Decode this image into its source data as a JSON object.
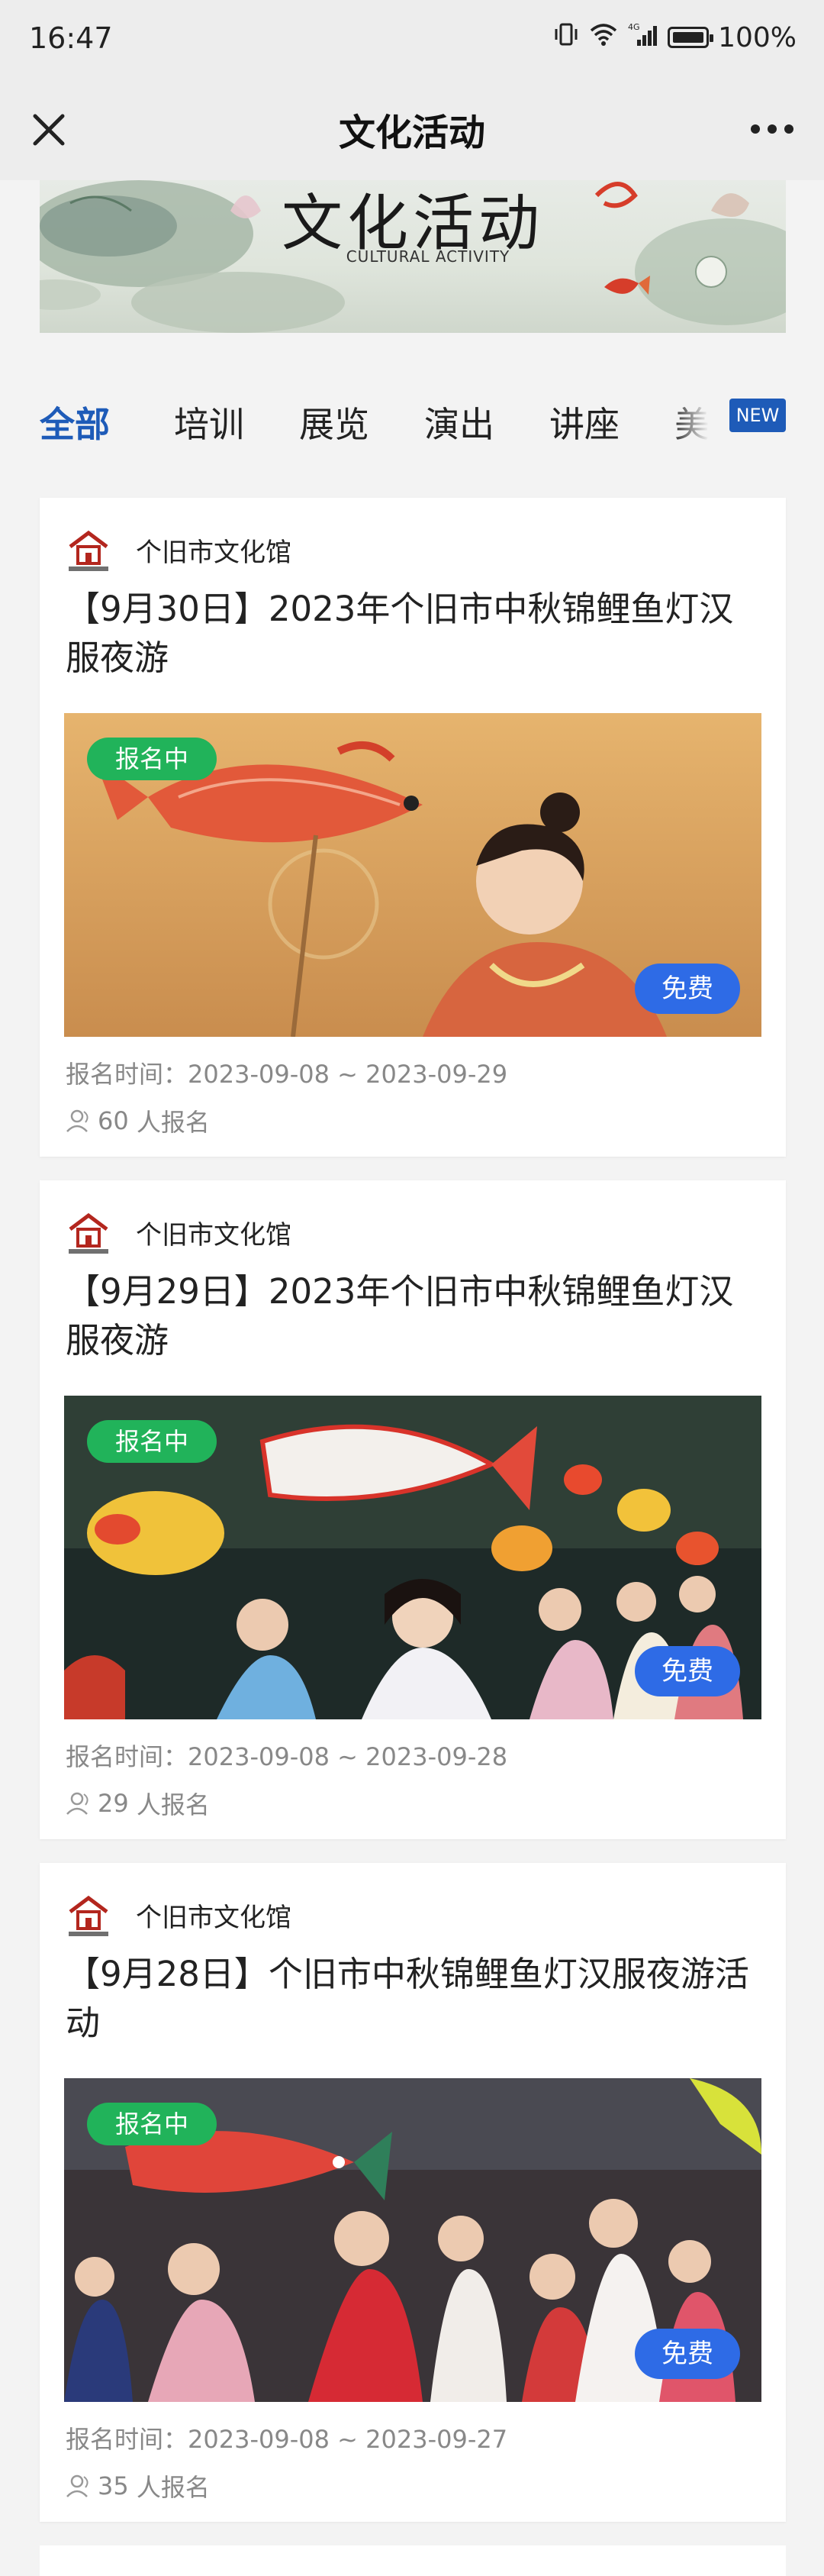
{
  "status_bar": {
    "time": "16:47",
    "battery": "100%",
    "network": "4G"
  },
  "nav": {
    "title": "文化活动",
    "close_icon": "close-icon",
    "more_icon": "more-icon"
  },
  "banner": {
    "title": "文化活动",
    "subtitle": "CULTURAL ACTIVITY"
  },
  "tabs": [
    {
      "label": "全部",
      "active": true
    },
    {
      "label": "培训",
      "active": false
    },
    {
      "label": "展览",
      "active": false
    },
    {
      "label": "演出",
      "active": false
    },
    {
      "label": "讲座",
      "active": false
    },
    {
      "label": "美",
      "active": false
    }
  ],
  "new_badge": "NEW",
  "labels": {
    "reg_time": "报名时间：",
    "people_suffix": "人报名"
  },
  "activities": [
    {
      "org": "个旧市文化馆",
      "title": "【9月30日】2023年个旧市中秋锦鲤鱼灯汉服夜游",
      "status": "报名中",
      "price": "免费",
      "reg_time": "2023-09-08 ~ 2023-09-29",
      "count": "60"
    },
    {
      "org": "个旧市文化馆",
      "title": "【9月29日】2023年个旧市中秋锦鲤鱼灯汉服夜游",
      "status": "报名中",
      "price": "免费",
      "reg_time": "2023-09-08 ~ 2023-09-28",
      "count": "29"
    },
    {
      "org": "个旧市文化馆",
      "title": "【9月28日】个旧市中秋锦鲤鱼灯汉服夜游活动",
      "status": "报名中",
      "price": "免费",
      "reg_time": "2023-09-08 ~ 2023-09-27",
      "count": "35"
    }
  ],
  "colors": {
    "accent": "#1e5bb8",
    "status_green": "#21b35a",
    "free_blue": "#2e6be6"
  }
}
